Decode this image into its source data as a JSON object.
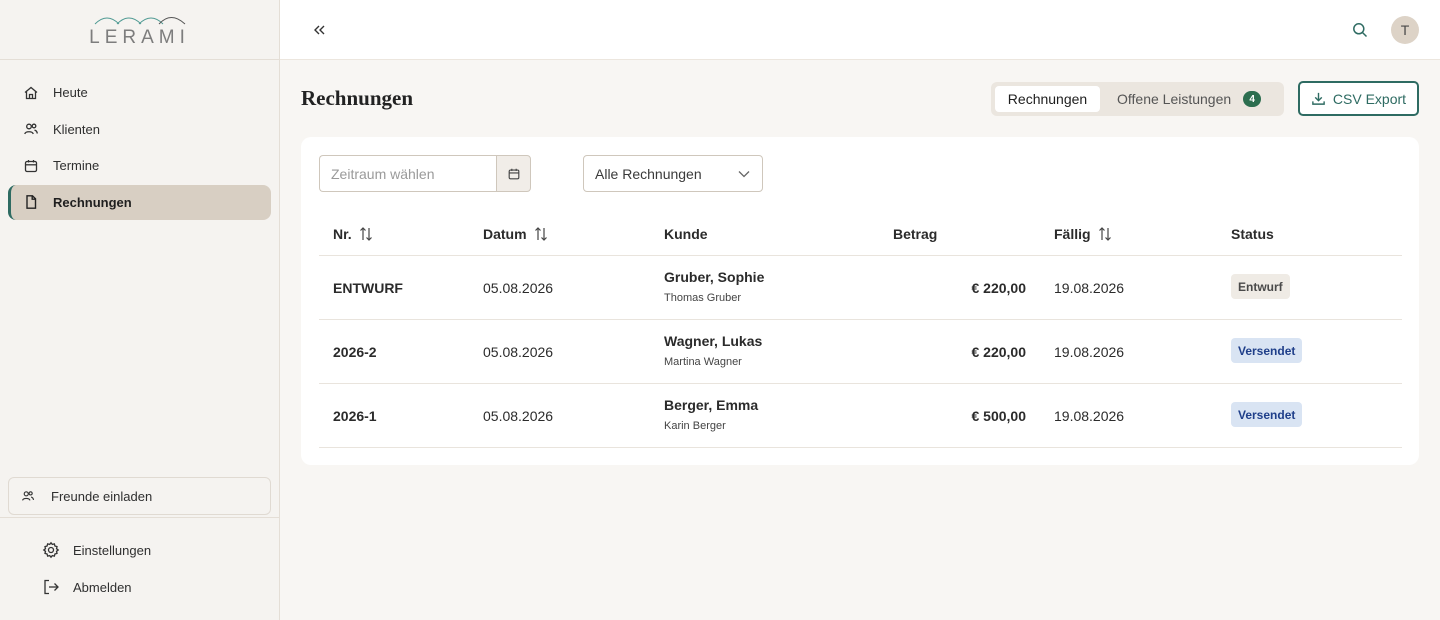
{
  "brand": {
    "name": "LERAMI"
  },
  "sidebar": {
    "items": [
      {
        "label": "Heute",
        "icon": "home-icon"
      },
      {
        "label": "Klienten",
        "icon": "users-icon"
      },
      {
        "label": "Termine",
        "icon": "calendar-icon"
      },
      {
        "label": "Rechnungen",
        "icon": "document-icon",
        "active": true
      }
    ],
    "invite_label": "Freunde einladen",
    "settings_label": "Einstellungen",
    "logout_label": "Abmelden"
  },
  "topbar": {
    "avatar_initial": "T"
  },
  "page": {
    "title": "Rechnungen"
  },
  "tabs": {
    "active_label": "Rechnungen",
    "inactive_label": "Offene Leistungen",
    "inactive_count": "4"
  },
  "toolbar": {
    "csv_label": "CSV Export"
  },
  "filters": {
    "date_placeholder": "Zeitraum wählen",
    "select_value": "Alle Rechnungen"
  },
  "table": {
    "headers": {
      "nr": "Nr.",
      "date": "Datum",
      "client": "Kunde",
      "amount": "Betrag",
      "due": "Fällig",
      "status": "Status"
    },
    "rows": [
      {
        "nr": "ENTWURF",
        "date": "05.08.2026",
        "client": "Gruber, Sophie",
        "contact": "Thomas Gruber",
        "amount": "€ 220,00",
        "due": "19.08.2026",
        "status": "Entwurf",
        "status_kind": "draft"
      },
      {
        "nr": "2026-2",
        "date": "05.08.2026",
        "client": "Wagner, Lukas",
        "contact": "Martina Wagner",
        "amount": "€ 220,00",
        "due": "19.08.2026",
        "status": "Versendet",
        "status_kind": "sent"
      },
      {
        "nr": "2026-1",
        "date": "05.08.2026",
        "client": "Berger, Emma",
        "contact": "Karin Berger",
        "amount": "€ 500,00",
        "due": "19.08.2026",
        "status": "Versendet",
        "status_kind": "sent"
      }
    ]
  },
  "colors": {
    "accent": "#2e6b62",
    "active_nav_bg": "#d8cfc3",
    "badge_green": "#2c6e4f",
    "sent_badge_bg": "#d9e4f3",
    "sent_badge_text": "#1f3f8a"
  }
}
